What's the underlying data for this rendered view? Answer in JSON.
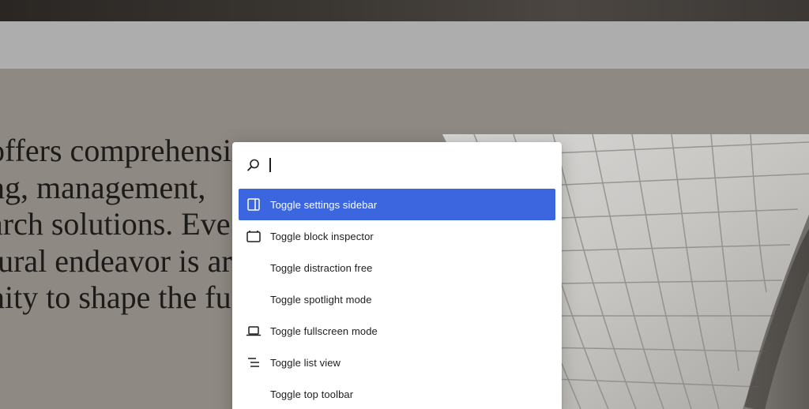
{
  "page": {
    "hero_lines": [
      "offers comprehensi",
      "ng, management, ",
      "arch solutions. Eve",
      "tural endeavor is ar",
      "nity to shape the fu"
    ]
  },
  "command_palette": {
    "search": {
      "value": "",
      "icon": "search-icon"
    },
    "items": [
      {
        "label": "Toggle settings sidebar",
        "icon": "sidebar-panel-icon",
        "active": true
      },
      {
        "label": "Toggle block inspector",
        "icon": "block-inspector-icon",
        "active": false
      },
      {
        "label": "Toggle distraction free",
        "icon": "",
        "active": false
      },
      {
        "label": "Toggle spotlight mode",
        "icon": "",
        "active": false
      },
      {
        "label": "Toggle fullscreen mode",
        "icon": "laptop-icon",
        "active": false
      },
      {
        "label": "Toggle list view",
        "icon": "list-view-icon",
        "active": false
      },
      {
        "label": "Toggle top toolbar",
        "icon": "",
        "active": false
      }
    ]
  },
  "colors": {
    "accent": "#3b66e0",
    "canvas": "#8e8982",
    "toolbar": "#adadad",
    "text": "#1e1e1e"
  }
}
